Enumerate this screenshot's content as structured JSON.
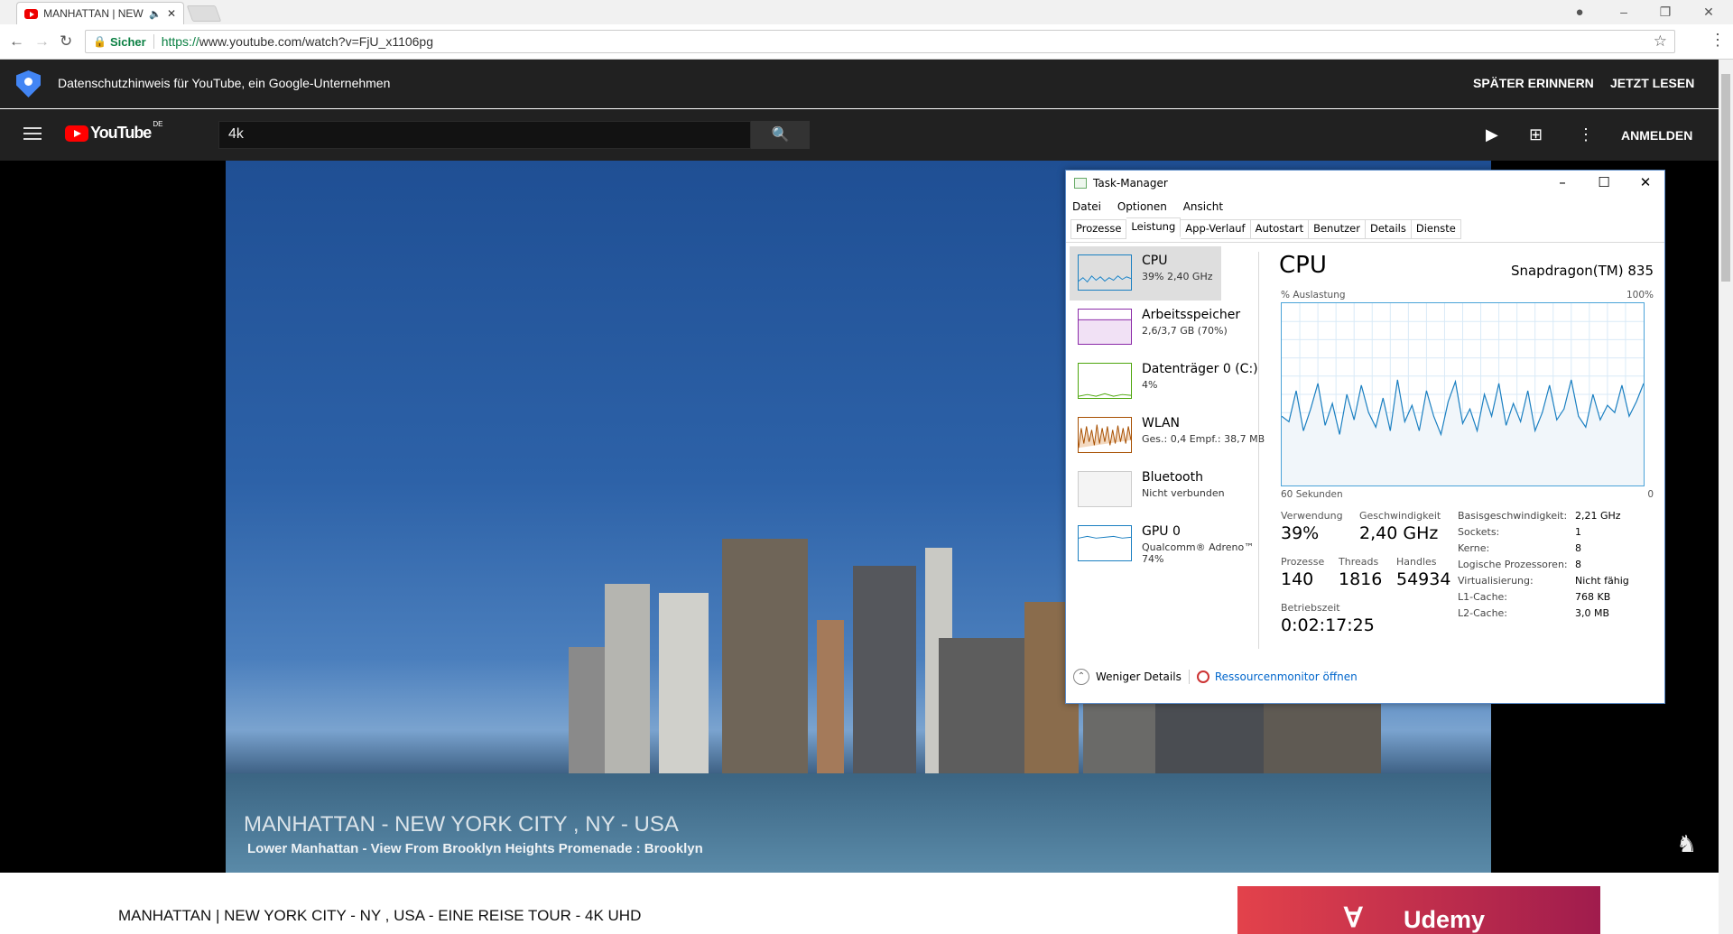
{
  "browser": {
    "tab_title": "MANHATTAN | NEW Y",
    "tab_audio_icon": "speaker-icon",
    "secure_label": "Sicher",
    "url_scheme": "https://",
    "url_rest": "www.youtube.com/watch?v=FjU_x1106pg"
  },
  "banner": {
    "text": "Datenschutzhinweis für YouTube, ein Google-Unternehmen",
    "remind_later": "SPÄTER ERINNERN",
    "read_now": "JETZT LESEN"
  },
  "youtube": {
    "logo_word": "YouTube",
    "logo_region": "DE",
    "search_value": "4k",
    "sign_in": "ANMELDEN"
  },
  "video": {
    "overlay_title": "MANHATTAN - NEW YORK CITY , NY - USA",
    "overlay_subtitle": "Lower Manhattan - View From Brooklyn Heights Promenade : Brooklyn",
    "page_title": "MANHATTAN | NEW YORK CITY - NY , USA - EINE REISE TOUR - 4K UHD"
  },
  "ad": {
    "brand": "Udemy"
  },
  "taskmanager": {
    "title": "Task-Manager",
    "menu": [
      "Datei",
      "Optionen",
      "Ansicht"
    ],
    "tabs": [
      "Prozesse",
      "Leistung",
      "App-Verlauf",
      "Autostart",
      "Benutzer",
      "Details",
      "Dienste"
    ],
    "active_tab": "Leistung",
    "sidebar": [
      {
        "name": "CPU",
        "sub": "39% 2,40 GHz",
        "color": "#1a7fc1"
      },
      {
        "name": "Arbeitsspeicher",
        "sub": "2,6/3,7 GB (70%)",
        "color": "#8b2aa8"
      },
      {
        "name": "Datenträger 0 (C:)",
        "sub": "4%",
        "color": "#4da60c"
      },
      {
        "name": "WLAN",
        "sub": "Ges.: 0,4 Empf.: 38,7 MB",
        "color": "#a74f01"
      },
      {
        "name": "Bluetooth",
        "sub": "Nicht verbunden",
        "color": "#999999"
      },
      {
        "name": "GPU 0",
        "sub": "Qualcomm® Adreno™",
        "sub2": "74%",
        "color": "#1a7fc1"
      }
    ],
    "main": {
      "heading": "CPU",
      "processor": "Snapdragon(TM) 835",
      "util_label": "% Auslastung",
      "max_label": "100%",
      "time_label": "60 Sekunden",
      "zero_label": "0",
      "stats": {
        "usage_k": "Verwendung",
        "usage_v": "39%",
        "speed_k": "Geschwindigkeit",
        "speed_v": "2,40 GHz",
        "proc_k": "Prozesse",
        "proc_v": "140",
        "threads_k": "Threads",
        "threads_v": "1816",
        "handles_k": "Handles",
        "handles_v": "54934",
        "uptime_k": "Betriebszeit",
        "uptime_v": "0:02:17:25"
      },
      "specs": [
        {
          "k": "Basisgeschwindigkeit:",
          "v": "2,21 GHz"
        },
        {
          "k": "Sockets:",
          "v": "1"
        },
        {
          "k": "Kerne:",
          "v": "8"
        },
        {
          "k": "Logische Prozessoren:",
          "v": "8"
        },
        {
          "k": "Virtualisierung:",
          "v": "Nicht fähig"
        },
        {
          "k": "L1-Cache:",
          "v": "768 KB"
        },
        {
          "k": "L2-Cache:",
          "v": "3,0 MB"
        }
      ],
      "cpu_history": [
        38,
        35,
        52,
        30,
        42,
        56,
        33,
        45,
        28,
        50,
        36,
        55,
        40,
        32,
        48,
        30,
        58,
        35,
        44,
        30,
        52,
        38,
        28,
        46,
        57,
        34,
        42,
        30,
        50,
        38,
        56,
        33,
        45,
        35,
        52,
        30,
        40,
        55,
        36,
        42,
        58,
        38,
        32,
        50,
        36,
        44,
        40,
        55,
        38,
        46,
        56
      ]
    },
    "footer": {
      "fewer_details": "Weniger Details",
      "resource_monitor": "Ressourcenmonitor öffnen"
    }
  }
}
